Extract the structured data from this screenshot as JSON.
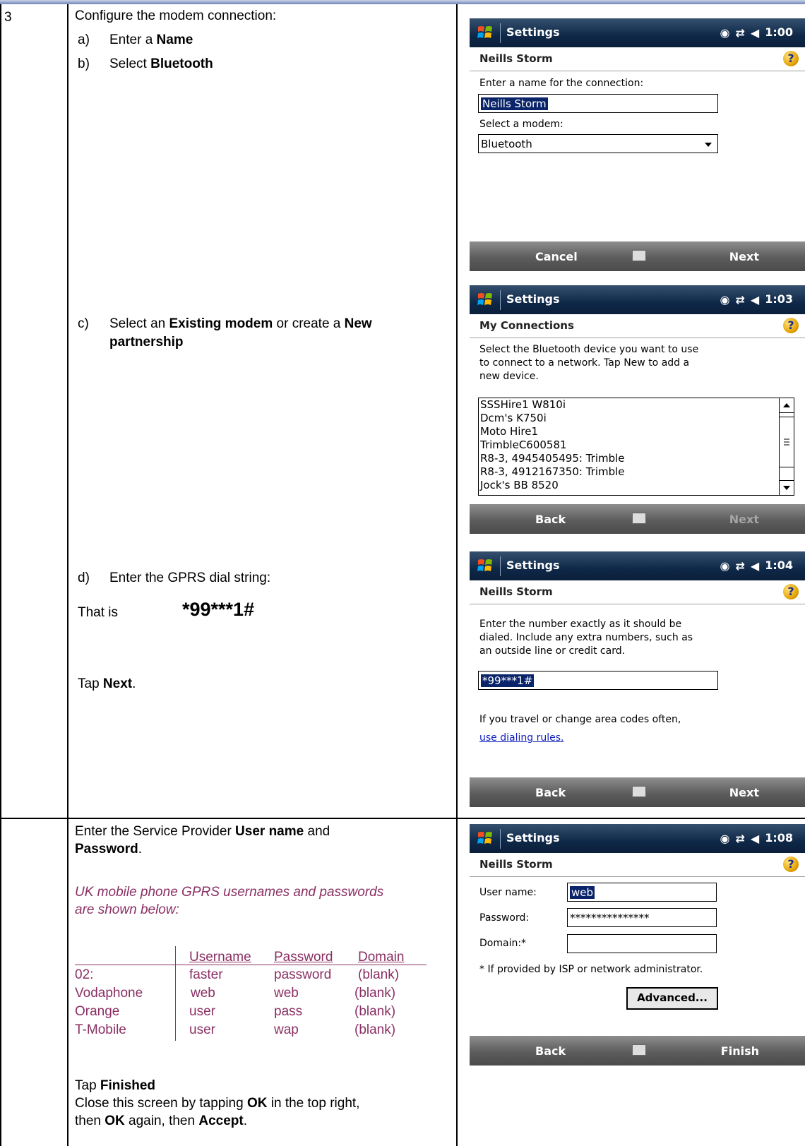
{
  "step_number": "3",
  "left": {
    "configure_title": "Configure the modem connection:",
    "a_label": "a)",
    "a_text": "Enter a ",
    "a_bold": "Name",
    "b_label": "b)",
    "b_text": "Select ",
    "b_bold": "Bluetooth",
    "c_label": "c)",
    "c_text1": "Select an ",
    "c_bold1": "Existing modem",
    "c_text2": " or create a ",
    "c_bold2": "New",
    "c_bold3": "partnership",
    "d_label": "d)",
    "d_text": "Enter the GPRS dial string:",
    "that_is": "That is",
    "dial_string": "*99***1#",
    "tap": "Tap ",
    "next_bold": "Next",
    "period": ".",
    "enter_sp1": "Enter the Service Provider ",
    "user_name_bold": "User name",
    "and": " and",
    "password_bold": "Password",
    "period2": ".",
    "uk_note1": "UK mobile phone GPRS usernames and passwords",
    "uk_note2": "are shown below:",
    "table_headers": [
      "Username",
      "Password",
      "Domain"
    ],
    "table_rows": [
      [
        "02:",
        "faster",
        "password",
        "(blank)"
      ],
      [
        "Vodaphone",
        "web",
        "web",
        "(blank)"
      ],
      [
        "Orange",
        "user",
        "pass",
        "(blank)"
      ],
      [
        "T-Mobile",
        "user",
        "wap",
        "(blank)"
      ]
    ],
    "tap_finished": "Tap ",
    "finished_bold": "Finished",
    "close_line1": "Close this screen by tapping ",
    "ok_bold": "OK",
    "close_line1b": " in the top right,",
    "close_line2a": "then ",
    "ok_bold2": "OK",
    "close_line2b": " again, then ",
    "accept_bold": "Accept",
    "period3": "."
  },
  "screen1": {
    "title": "Settings",
    "time": "1:00",
    "header": "Neills Storm",
    "name_prompt": "Enter a name for the connection:",
    "name_value": "Neills Storm",
    "modem_prompt": "Select a modem:",
    "modem_value": "Bluetooth",
    "soft_left": "Cancel",
    "soft_right": "Next"
  },
  "screen2": {
    "title": "Settings",
    "time": "1:03",
    "header": "My Connections",
    "instr1": "Select the Bluetooth device you want to use",
    "instr2": "to connect to a network. Tap New to add a",
    "instr3": "new device.",
    "devices": [
      "SSSHire1 W810i",
      "Dcm's K750i",
      "Moto Hire1",
      "TrimbleC600581",
      "R8-3, 4945405495: Trimble",
      "R8-3, 4912167350: Trimble",
      "Jock's BB 8520"
    ],
    "soft_left": "Back",
    "soft_right": "Next"
  },
  "screen3": {
    "title": "Settings",
    "time": "1:04",
    "header": "Neills Storm",
    "instr1": "Enter the number exactly as it should be",
    "instr2": "dialed.  Include any extra numbers, such as",
    "instr3": "an outside line or credit card.",
    "number_value": "*99***1#",
    "travel": "If you travel or change area codes often,",
    "link": "use dialing rules.",
    "soft_left": "Back",
    "soft_right": "Next"
  },
  "screen4": {
    "title": "Settings",
    "time": "1:08",
    "header": "Neills Storm",
    "user_label": "User name:",
    "user_value": "web",
    "pass_label": "Password:",
    "pass_value": "***************",
    "domain_label": "Domain:*",
    "domain_value": "",
    "note": "* If provided by ISP or network administrator.",
    "advanced": "Advanced...",
    "soft_left": "Back",
    "soft_right": "Finish"
  },
  "colors": {
    "title_bar": "#0f2848",
    "soft_bar": "#5c5c5c",
    "note_text": "#8a2f63"
  }
}
